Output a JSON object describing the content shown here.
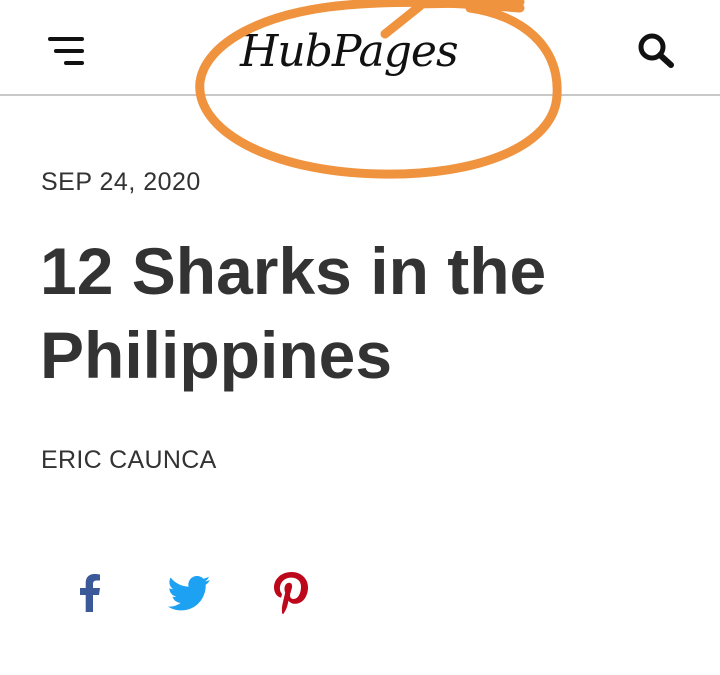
{
  "header": {
    "logo_text": "HubPages",
    "menu_icon": "hamburger-menu-icon",
    "search_icon": "search-icon"
  },
  "article": {
    "date": "SEP 24, 2020",
    "title": "12 Sharks in the Philippines",
    "author": "ERIC CAUNCA"
  },
  "share": {
    "items": [
      {
        "icon": "facebook-icon",
        "color": "#3b5998"
      },
      {
        "icon": "twitter-icon",
        "color": "#1da1f2"
      },
      {
        "icon": "pinterest-icon",
        "color": "#bd081c"
      }
    ]
  },
  "annotation": {
    "color": "#f0933f"
  }
}
